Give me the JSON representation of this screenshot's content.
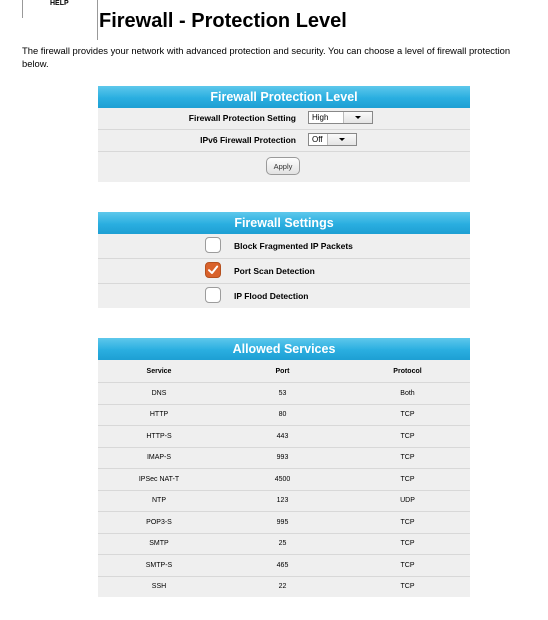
{
  "help": {
    "label": "HELP"
  },
  "page": {
    "title": "Firewall - Protection Level",
    "intro": "The firewall provides your network with advanced protection and security. You can choose a level of firewall protection below."
  },
  "protection_panel": {
    "title": "Firewall Protection Level",
    "setting_label": "Firewall Protection Setting",
    "setting_value": "High",
    "ipv6_label": "IPv6 Firewall Protection",
    "ipv6_value": "Off",
    "apply_label": "Apply"
  },
  "settings_panel": {
    "title": "Firewall Settings",
    "options": [
      {
        "label": "Block Fragmented IP Packets",
        "checked": false
      },
      {
        "label": "Port Scan Detection",
        "checked": true
      },
      {
        "label": "IP Flood Detection",
        "checked": false
      }
    ],
    "checked_color": "#d9622b"
  },
  "services_panel": {
    "title": "Allowed Services",
    "columns": [
      "Service",
      "Port",
      "Protocol"
    ],
    "rows": [
      [
        "DNS",
        "53",
        "Both"
      ],
      [
        "HTTP",
        "80",
        "TCP"
      ],
      [
        "HTTP-S",
        "443",
        "TCP"
      ],
      [
        "IMAP-S",
        "993",
        "TCP"
      ],
      [
        "IPSec NAT-T",
        "4500",
        "TCP"
      ],
      [
        "NTP",
        "123",
        "UDP"
      ],
      [
        "POP3-S",
        "995",
        "TCP"
      ],
      [
        "SMTP",
        "25",
        "TCP"
      ],
      [
        "SMTP-S",
        "465",
        "TCP"
      ],
      [
        "SSH",
        "22",
        "TCP"
      ]
    ]
  },
  "colors": {
    "header_blue": "#2aaee0",
    "panel_bg": "#efefef"
  }
}
